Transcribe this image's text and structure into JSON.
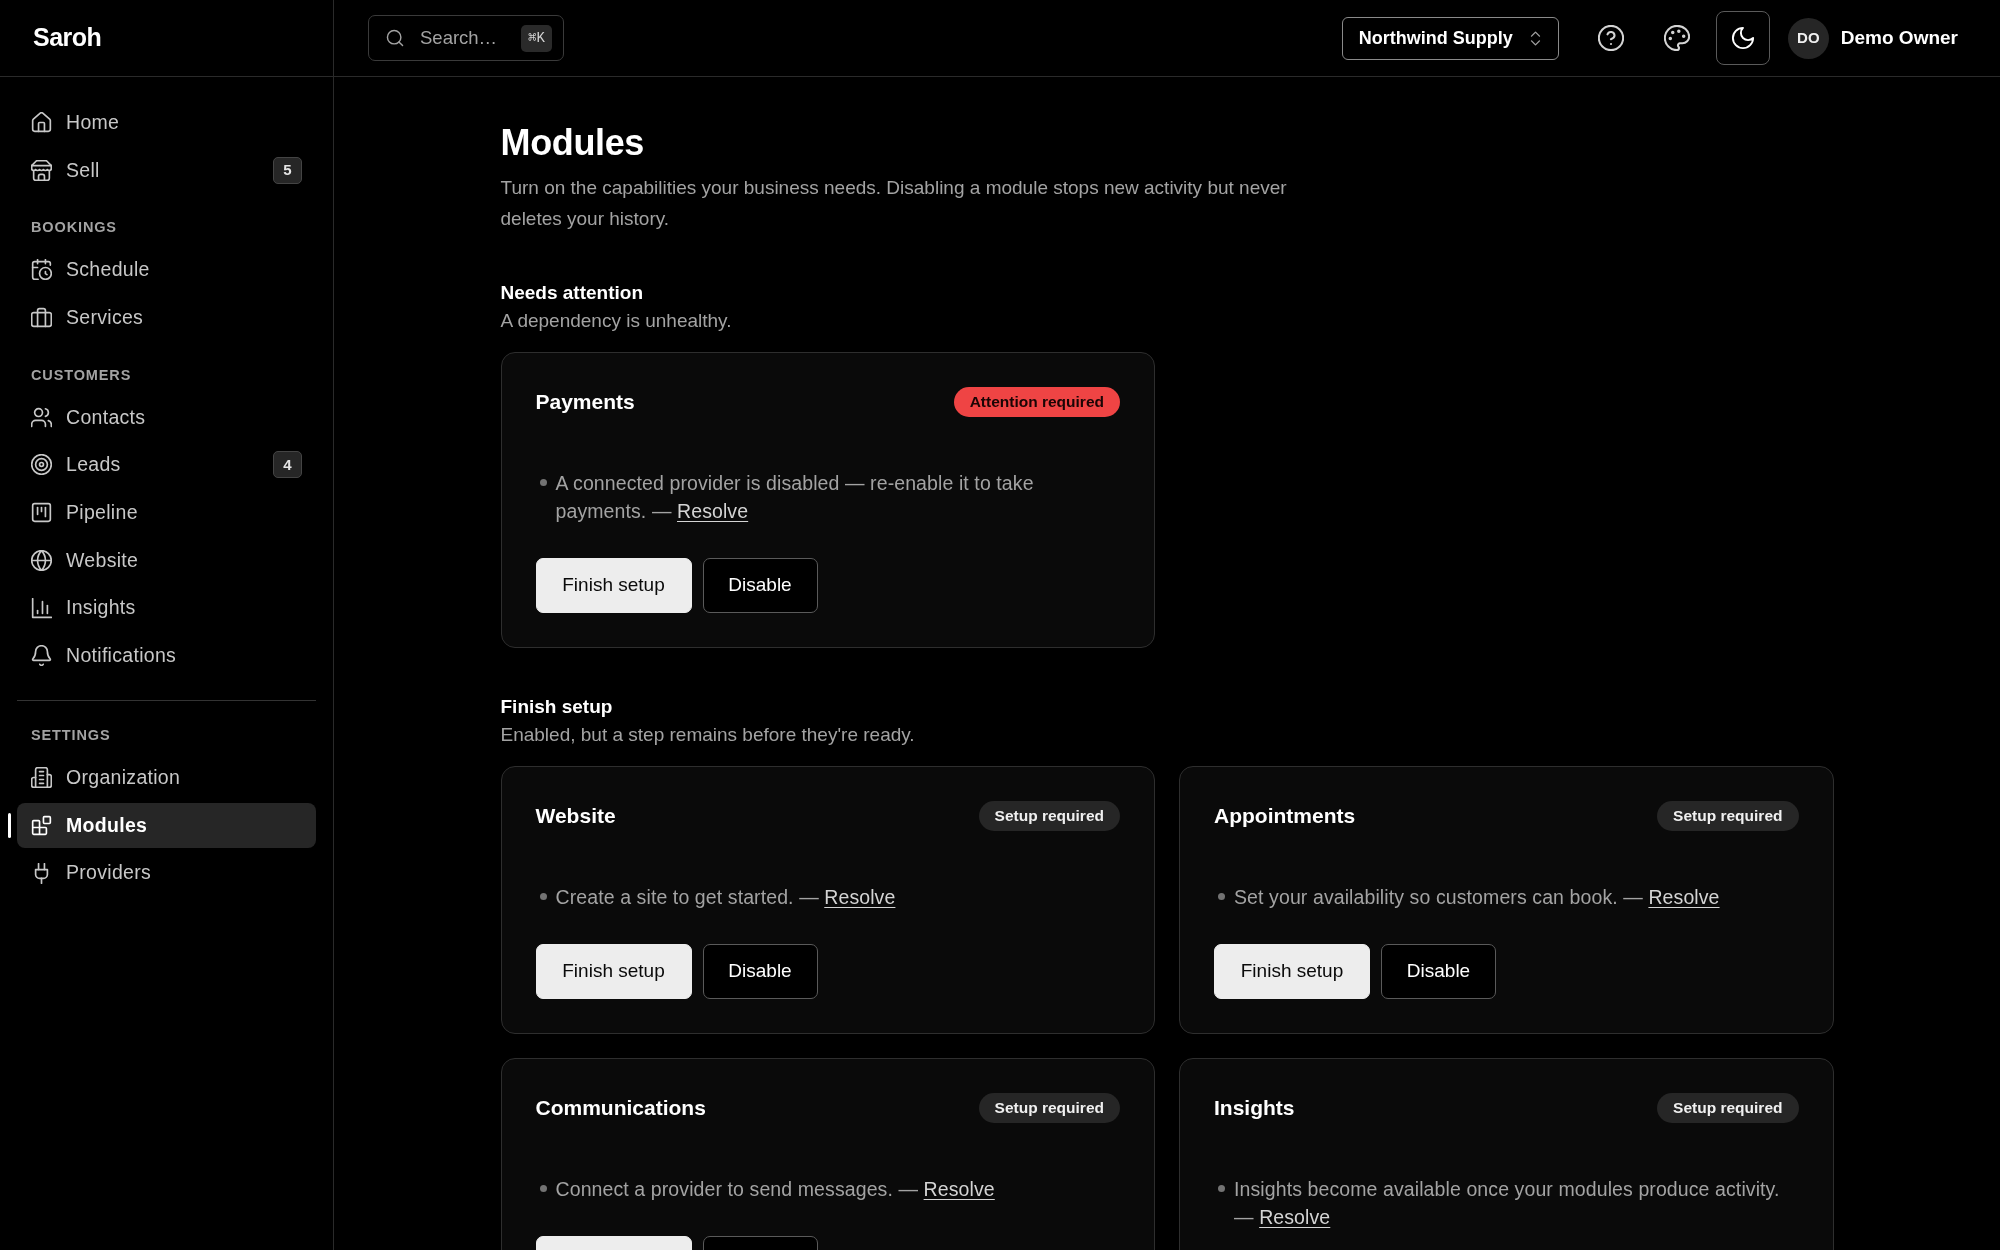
{
  "sidebar": {
    "brand": "Saroh",
    "sections": [
      {
        "divider": false,
        "items": [
          {
            "label": "Home",
            "selected": false
          },
          {
            "label": "Sell",
            "badge": "5",
            "selected": false
          }
        ]
      },
      {
        "divider": false,
        "title": "BOOKINGS",
        "items": [
          {
            "label": "Schedule",
            "selected": false
          },
          {
            "label": "Services",
            "selected": false
          }
        ]
      },
      {
        "divider": false,
        "title": "CUSTOMERS",
        "items": [
          {
            "label": "Contacts",
            "selected": false
          },
          {
            "label": "Leads",
            "badge": "4",
            "selected": false
          },
          {
            "label": "Pipeline",
            "selected": false
          },
          {
            "label": "Website",
            "selected": false
          },
          {
            "label": "Insights",
            "selected": false
          },
          {
            "label": "Notifications",
            "selected": false
          }
        ]
      },
      {
        "divider": true,
        "title": "SETTINGS",
        "items": [
          {
            "label": "Organization",
            "selected": false
          },
          {
            "label": "Modules",
            "selected": true
          },
          {
            "label": "Providers",
            "selected": false
          }
        ]
      }
    ]
  },
  "topbar": {
    "search": {
      "placeholder": "Search…",
      "shortcut": "⌘K"
    },
    "workspace": "Northwind Supply",
    "icon_buttons": [
      {
        "pressed": false
      },
      {
        "pressed": false
      },
      {
        "pressed": true
      }
    ],
    "user": {
      "initials": "DO",
      "name": "Demo Owner"
    }
  },
  "page": {
    "title": "Modules",
    "description": "Turn on the capabilities your business needs. Disabling a module stops new activity but never deletes your history."
  },
  "groups": [
    {
      "title": "Needs attention",
      "subtitle": "A dependency is unhealthy.",
      "modules": [
        {
          "name": "Payments",
          "status": {
            "label": "Attention required",
            "kind": "attention"
          },
          "issues": [
            {
              "text": "A connected provider is disabled — re-enable it to take payments.",
              "separator": "—",
              "link": "Resolve"
            }
          ],
          "actions": [
            {
              "kind": "primary",
              "label": "Finish setup"
            },
            {
              "kind": "outline",
              "label": "Disable"
            }
          ]
        }
      ]
    },
    {
      "title": "Finish setup",
      "subtitle": "Enabled, but a step remains before they're ready.",
      "modules": [
        {
          "name": "Website",
          "status": {
            "label": "Setup required",
            "kind": "setup"
          },
          "issues": [
            {
              "text": "Create a site to get started.",
              "separator": "—",
              "link": "Resolve"
            }
          ],
          "actions": [
            {
              "kind": "primary",
              "label": "Finish setup"
            },
            {
              "kind": "outline",
              "label": "Disable"
            }
          ]
        },
        {
          "name": "Appointments",
          "status": {
            "label": "Setup required",
            "kind": "setup"
          },
          "issues": [
            {
              "text": "Set your availability so customers can book.",
              "separator": "—",
              "link": "Resolve"
            }
          ],
          "actions": [
            {
              "kind": "primary",
              "label": "Finish setup"
            },
            {
              "kind": "outline",
              "label": "Disable"
            }
          ]
        },
        {
          "name": "Communications",
          "status": {
            "label": "Setup required",
            "kind": "setup"
          },
          "issues": [
            {
              "text": "Connect a provider to send messages.",
              "separator": "—",
              "link": "Resolve"
            }
          ],
          "actions": [
            {
              "kind": "primary"
            },
            {
              "kind": "outline"
            }
          ]
        },
        {
          "name": "Insights",
          "status": {
            "label": "Setup required",
            "kind": "setup"
          },
          "issues": [
            {
              "text": "Insights become available once your modules produce activity.",
              "separator": "—",
              "link": "Resolve"
            }
          ]
        }
      ]
    }
  ]
}
